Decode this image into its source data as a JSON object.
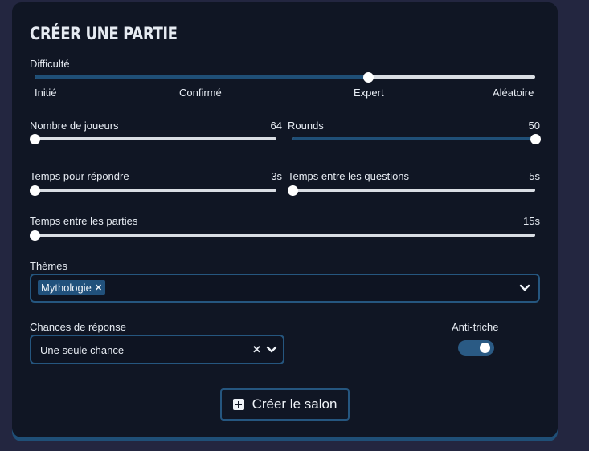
{
  "title": "Créer une partie",
  "difficulty": {
    "label": "Difficulté",
    "levels": [
      "Initié",
      "Confirmé",
      "Expert",
      "Aléatoire"
    ],
    "selected_index": 2
  },
  "players": {
    "label": "Nombre de joueurs",
    "value": "64",
    "fraction": 0.0
  },
  "rounds": {
    "label": "Rounds",
    "value": "50",
    "fraction": 1.0
  },
  "answer_time": {
    "label": "Temps pour répondre",
    "value": "3s",
    "fraction": 0.0
  },
  "question_gap": {
    "label": "Temps entre les questions",
    "value": "5s",
    "fraction": 0.0
  },
  "game_gap": {
    "label": "Temps entre les parties",
    "value": "15s",
    "fraction": 0.0
  },
  "themes": {
    "label": "Thèmes",
    "chips": [
      "Mythologie"
    ],
    "chip_remove": "✕",
    "dropdown_icon": "chevron-down-icon"
  },
  "answer_chances": {
    "label": "Chances de réponse",
    "value": "Une seule chance",
    "clear_icon": "✕",
    "dropdown_icon": "chevron-down-icon"
  },
  "anti_cheat": {
    "label": "Anti-triche",
    "enabled": true
  },
  "create_button": {
    "label": "Créer le salon",
    "icon": "plus-square-icon"
  },
  "colors": {
    "background": "#232640",
    "panel": "#101624",
    "accent": "#1f4f77",
    "border": "#25567f",
    "track": "#d9dde3",
    "text": "#e6ebf2"
  }
}
